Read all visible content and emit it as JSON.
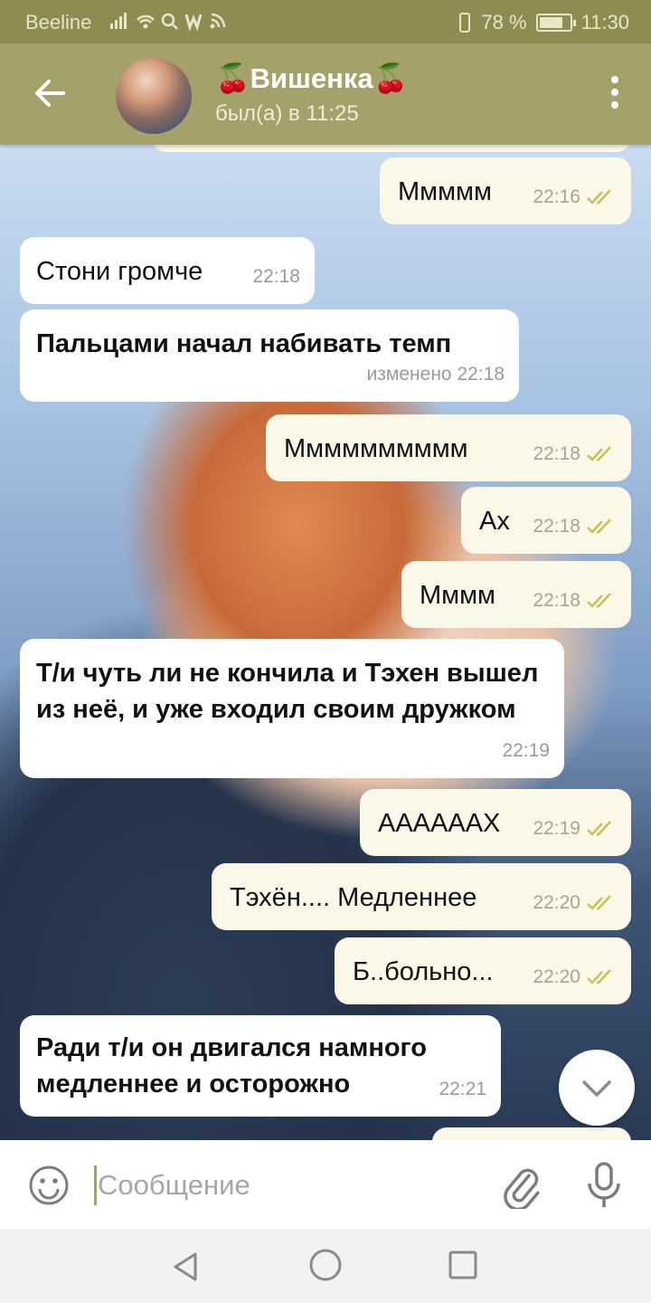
{
  "status_bar": {
    "carrier": "Beeline",
    "icons": "ᴵ▄◡ Q w ⧄",
    "battery_text": "78 %",
    "battery_level": 0.78,
    "time": "11:30"
  },
  "header": {
    "title": "🍒Вишенка🍒",
    "status": "был(а) в 11:25"
  },
  "messages": [
    {
      "dir": "out",
      "text": "Ммммм",
      "time": "22:16"
    },
    {
      "dir": "in",
      "text": "Стони громче",
      "time": "22:18"
    },
    {
      "dir": "in",
      "text": "Пальцами начал набивать темп",
      "time": "изменено 22:18"
    },
    {
      "dir": "out",
      "text": "Мммммммммм",
      "time": "22:18"
    },
    {
      "dir": "out",
      "text": "Ах",
      "time": "22:18"
    },
    {
      "dir": "out",
      "text": "Мммм",
      "time": "22:18"
    },
    {
      "dir": "in",
      "text": "Т/и чуть ли не кончила и Тэхен вышел из неё, и уже входил своим дружком",
      "time": "22:19"
    },
    {
      "dir": "out",
      "text": "ААААААХ",
      "time": "22:19"
    },
    {
      "dir": "out",
      "text": "Тэхён.... Медленнее",
      "time": "22:20"
    },
    {
      "dir": "out",
      "text": "Б..больно...",
      "time": "22:20"
    },
    {
      "dir": "in",
      "text": "Ради т/и он двигался намного медленнее и осторожно",
      "time": "22:21"
    }
  ],
  "input": {
    "placeholder": "Сообщение"
  },
  "icons": [
    "back-arrow-icon",
    "more-vert-icon",
    "chevron-down-icon",
    "emoji-icon",
    "attach-icon",
    "mic-icon",
    "nav-back-icon",
    "nav-home-icon",
    "nav-recent-icon"
  ],
  "colors": {
    "header": "#a5a16a",
    "status_bar": "#8f8c53",
    "outgoing_bubble": "#fbf8e8",
    "incoming_bubble": "#ffffff",
    "read_ticks": "#c9bf5a"
  }
}
